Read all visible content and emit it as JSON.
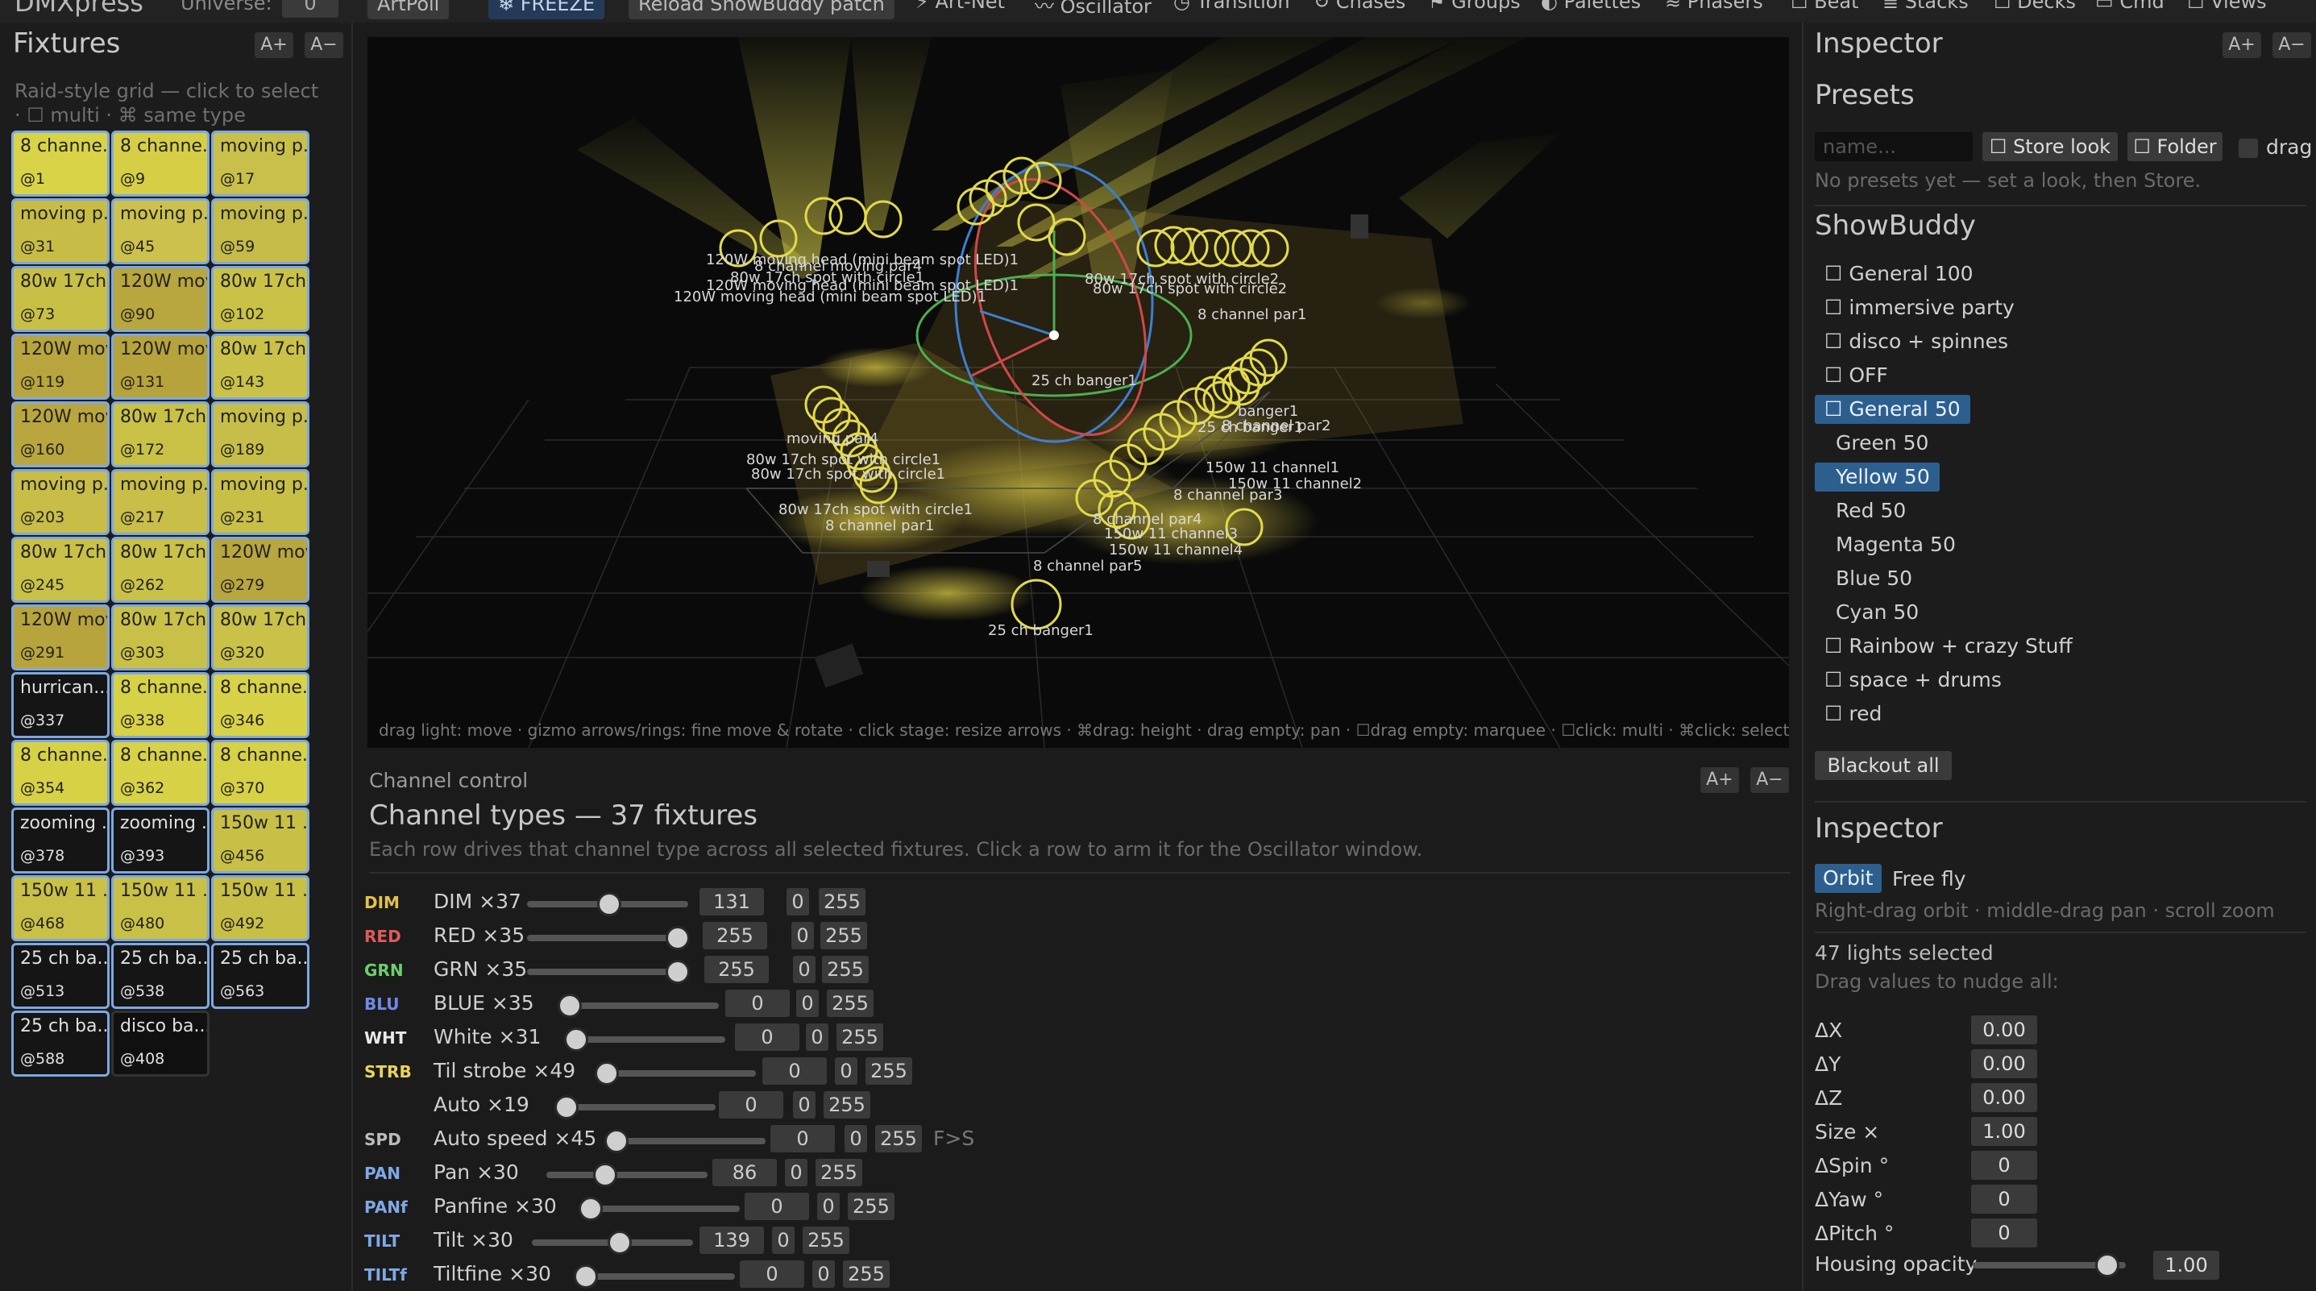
{
  "app": {
    "name": "DMXpress",
    "universe_label": "Universe:",
    "universe_value": "0"
  },
  "toolbar": {
    "artpoll": "ArtPoll",
    "freeze": "❄ FREEZE",
    "reload": "Reload ShowBuddy patch",
    "tabs": [
      "Art-Net",
      "Oscillator",
      "Transition",
      "Chases",
      "Groups",
      "Palettes",
      "Phasers",
      "Beat",
      "Stacks",
      "Decks",
      "Cmd",
      "Views"
    ]
  },
  "fixtures": {
    "title": "Fixtures",
    "font_up": "A+",
    "font_down": "A−",
    "hint": "Raid-style grid — click to select · ☐ multi · ⌘ same type",
    "tiles": [
      {
        "name": "8 channe...",
        "addr": "@1",
        "color": "#d9d447"
      },
      {
        "name": "8 channe...",
        "addr": "@9",
        "color": "#d6cf45"
      },
      {
        "name": "moving p...",
        "addr": "@17",
        "color": "#c9c04a"
      },
      {
        "name": "moving p...",
        "addr": "@31",
        "color": "#c7bd46"
      },
      {
        "name": "moving p...",
        "addr": "@45",
        "color": "#cbc14c"
      },
      {
        "name": "moving p...",
        "addr": "@59",
        "color": "#c4bb48"
      },
      {
        "name": "80w 17ch...",
        "addr": "@73",
        "color": "#c8c046"
      },
      {
        "name": "120W mov",
        "addr": "@90",
        "color": "#b8a63e"
      },
      {
        "name": "80w 17ch...",
        "addr": "@102",
        "color": "#c9c247"
      },
      {
        "name": "120W mov",
        "addr": "@119",
        "color": "#b8a53d"
      },
      {
        "name": "120W mov",
        "addr": "@131",
        "color": "#b6a33c"
      },
      {
        "name": "80w 17ch...",
        "addr": "@143",
        "color": "#cac248"
      },
      {
        "name": "120W mov",
        "addr": "@160",
        "color": "#b9a63e"
      },
      {
        "name": "80w 17ch...",
        "addr": "@172",
        "color": "#c8c146"
      },
      {
        "name": "moving p...",
        "addr": "@189",
        "color": "#c6be48"
      },
      {
        "name": "moving p...",
        "addr": "@203",
        "color": "#c7bd47"
      },
      {
        "name": "moving p...",
        "addr": "@217",
        "color": "#c8be48"
      },
      {
        "name": "moving p...",
        "addr": "@231",
        "color": "#c8bf47"
      },
      {
        "name": "80w 17ch...",
        "addr": "@245",
        "color": "#c9c147"
      },
      {
        "name": "80w 17ch...",
        "addr": "@262",
        "color": "#c9c148"
      },
      {
        "name": "120W mov",
        "addr": "@279",
        "color": "#b8a63e"
      },
      {
        "name": "120W mov",
        "addr": "@291",
        "color": "#b7a43d"
      },
      {
        "name": "80w 17ch...",
        "addr": "@303",
        "color": "#c9c147"
      },
      {
        "name": "80w 17ch...",
        "addr": "@320",
        "color": "#c9c148"
      },
      {
        "name": "hurrican...",
        "addr": "@337",
        "color": "dark"
      },
      {
        "name": "8 channe...",
        "addr": "@338",
        "color": "#d7d146"
      },
      {
        "name": "8 channe...",
        "addr": "@346",
        "color": "#d8d247"
      },
      {
        "name": "8 channe...",
        "addr": "@354",
        "color": "#d7d146"
      },
      {
        "name": "8 channe...",
        "addr": "@362",
        "color": "#d8d247"
      },
      {
        "name": "8 channe...",
        "addr": "@370",
        "color": "#d7d146"
      },
      {
        "name": "zooming ...",
        "addr": "@378",
        "color": "dark"
      },
      {
        "name": "zooming ...",
        "addr": "@393",
        "color": "dark"
      },
      {
        "name": "150w 11 ...",
        "addr": "@456",
        "color": "#c8bf46"
      },
      {
        "name": "150w 11 ...",
        "addr": "@468",
        "color": "#c9c047"
      },
      {
        "name": "150w 11 ...",
        "addr": "@480",
        "color": "#c9c047"
      },
      {
        "name": "150w 11 ...",
        "addr": "@492",
        "color": "#c8bf46"
      },
      {
        "name": "25 ch ba...",
        "addr": "@513",
        "color": "dark"
      },
      {
        "name": "25 ch ba...",
        "addr": "@538",
        "color": "dark"
      },
      {
        "name": "25 ch ba...",
        "addr": "@563",
        "color": "dark"
      },
      {
        "name": "25 ch ba...",
        "addr": "@588",
        "color": "dark"
      },
      {
        "name": "disco ba...",
        "addr": "@408",
        "color": "dark2"
      }
    ]
  },
  "viewport": {
    "hint": "drag light: move · gizmo arrows/rings: fine move & rotate · click stage: resize arrows · ⌘drag: height · drag empty: pan · ☐drag empty: marquee · ☐click: multi · ⌘click: select type · ⌘Z: undo",
    "labels": [
      {
        "t": "120W moving head (mini beam spot LED)1"
      },
      {
        "t": "8 channel moving par4"
      },
      {
        "t": "80w 17ch spot with circle1"
      },
      {
        "t": "120W moving head (mini beam spot LED)1"
      },
      {
        "t": "120W moving head (mini beam spot LED)1"
      },
      {
        "t": "moving par4"
      },
      {
        "t": "80w 17ch spot with circle1"
      },
      {
        "t": "80w 17ch spot with circle1"
      },
      {
        "t": "80w 17ch spot with circle1"
      },
      {
        "t": "8 channel par1"
      },
      {
        "t": "25 ch banger1"
      },
      {
        "t": "25 ch banger1"
      },
      {
        "t": "80w 17ch spot with circle2"
      },
      {
        "t": "80w 17ch spot with circle2"
      },
      {
        "t": "8 channel par1"
      },
      {
        "t": "150w 11 channel1"
      },
      {
        "t": "150w 11 channel2"
      },
      {
        "t": "8 channel par3"
      },
      {
        "t": "8 channel par4"
      },
      {
        "t": "150w 11 channel3"
      },
      {
        "t": "150w 11 channel4"
      },
      {
        "t": "8 channel par5"
      },
      {
        "t": "25 ch banger1"
      },
      {
        "t": "8 channel par2"
      },
      {
        "t": "banger1"
      }
    ]
  },
  "channel_control": {
    "section": "Channel control",
    "font_up": "A+",
    "font_down": "A−",
    "title": "Channel types — 37 fixtures",
    "hint": "Each row drives that channel type across all selected fixtures. Click a row to arm it for the Oscillator window.",
    "rows": [
      {
        "tag": "DIM",
        "tag_color": "#e3c14a",
        "name": "DIM ×37",
        "value": "131",
        "min": "0",
        "max": "255",
        "level": 0.51
      },
      {
        "tag": "RED",
        "tag_color": "#e05a5a",
        "name": "RED ×35",
        "value": "255",
        "min": "0",
        "max": "255",
        "level": 1.0
      },
      {
        "tag": "GRN",
        "tag_color": "#6ccf6c",
        "name": "GRN ×35",
        "value": "255",
        "min": "0",
        "max": "255",
        "level": 1.0
      },
      {
        "tag": "BLU",
        "tag_color": "#6f8ae8",
        "name": "BLUE ×35",
        "value": "0",
        "min": "0",
        "max": "255",
        "level": 0
      },
      {
        "tag": "WHT",
        "tag_color": "#e8e8e8",
        "name": "White ×31",
        "value": "0",
        "min": "0",
        "max": "255",
        "level": 0
      },
      {
        "tag": "STRB",
        "tag_color": "#e9d55a",
        "name": "Til strobe ×49",
        "value": "0",
        "min": "0",
        "max": "255",
        "level": 0
      },
      {
        "tag": "",
        "tag_color": "#999",
        "name": "Auto ×19",
        "value": "0",
        "min": "0",
        "max": "255",
        "level": 0
      },
      {
        "tag": "SPD",
        "tag_color": "#bbbbbb",
        "name": "Auto speed ×45",
        "value": "0",
        "min": "0",
        "max": "255",
        "level": 0,
        "extra": "F>S"
      },
      {
        "tag": "PAN",
        "tag_color": "#7fa8e6",
        "name": "Pan ×30",
        "value": "86",
        "min": "0",
        "max": "255",
        "level": 0.34
      },
      {
        "tag": "PANf",
        "tag_color": "#7fa8e6",
        "name": "Panfine ×30",
        "value": "0",
        "min": "0",
        "max": "255",
        "level": 0
      },
      {
        "tag": "TILT",
        "tag_color": "#7fa8e6",
        "name": "Tilt ×30",
        "value": "139",
        "min": "0",
        "max": "255",
        "level": 0.55
      },
      {
        "tag": "TILTf",
        "tag_color": "#7fa8e6",
        "name": "Tiltfine ×30",
        "value": "0",
        "min": "0",
        "max": "255",
        "level": 0
      }
    ]
  },
  "inspector": {
    "title": "Inspector",
    "font_up": "A+",
    "font_down": "A−",
    "presets": {
      "title": "Presets",
      "name_placeholder": "name...",
      "store": "☐ Store look",
      "folder": "☐ Folder",
      "drag": "drag",
      "empty": "No presets yet — set a look, then Store."
    },
    "showbuddy": {
      "title": "ShowBuddy",
      "items": [
        {
          "label": "☐ General 100",
          "sel": false,
          "indent": false
        },
        {
          "label": "☐ immersive party",
          "sel": false,
          "indent": false
        },
        {
          "label": "☐ disco + spinnes",
          "sel": false,
          "indent": false
        },
        {
          "label": "☐ OFF",
          "sel": false,
          "indent": false
        },
        {
          "label": "☐ General 50",
          "sel": true,
          "indent": false
        },
        {
          "label": "Green 50",
          "sel": false,
          "indent": true
        },
        {
          "label": "Yellow 50",
          "sel": true,
          "indent": true
        },
        {
          "label": "Red 50",
          "sel": false,
          "indent": true
        },
        {
          "label": "Magenta 50",
          "sel": false,
          "indent": true
        },
        {
          "label": "Blue 50",
          "sel": false,
          "indent": true
        },
        {
          "label": "Cyan 50",
          "sel": false,
          "indent": true
        },
        {
          "label": "☐ Rainbow + crazy Stuff",
          "sel": false,
          "indent": false
        },
        {
          "label": "☐ space + drums",
          "sel": false,
          "indent": false
        },
        {
          "label": "☐ red",
          "sel": false,
          "indent": false
        }
      ],
      "blackout": "Blackout all"
    },
    "inspector2": {
      "title": "Inspector",
      "orbit": "Orbit",
      "freefly": "Free fly",
      "cam_hint": "Right-drag orbit · middle-drag pan · scroll zoom",
      "selected": "47 lights selected",
      "nudge": "Drag values to nudge all:",
      "fields": [
        {
          "label": "ΔX",
          "value": "0.00"
        },
        {
          "label": "ΔY",
          "value": "0.00"
        },
        {
          "label": "ΔZ",
          "value": "0.00"
        },
        {
          "label": "Size ×",
          "value": "1.00"
        },
        {
          "label": "ΔSpin °",
          "value": "0"
        },
        {
          "label": "ΔYaw °",
          "value": "0"
        },
        {
          "label": "ΔPitch °",
          "value": "0"
        }
      ],
      "housing_label": "Housing opacity",
      "housing_value": "1.00",
      "housing_level": 0.95
    }
  }
}
